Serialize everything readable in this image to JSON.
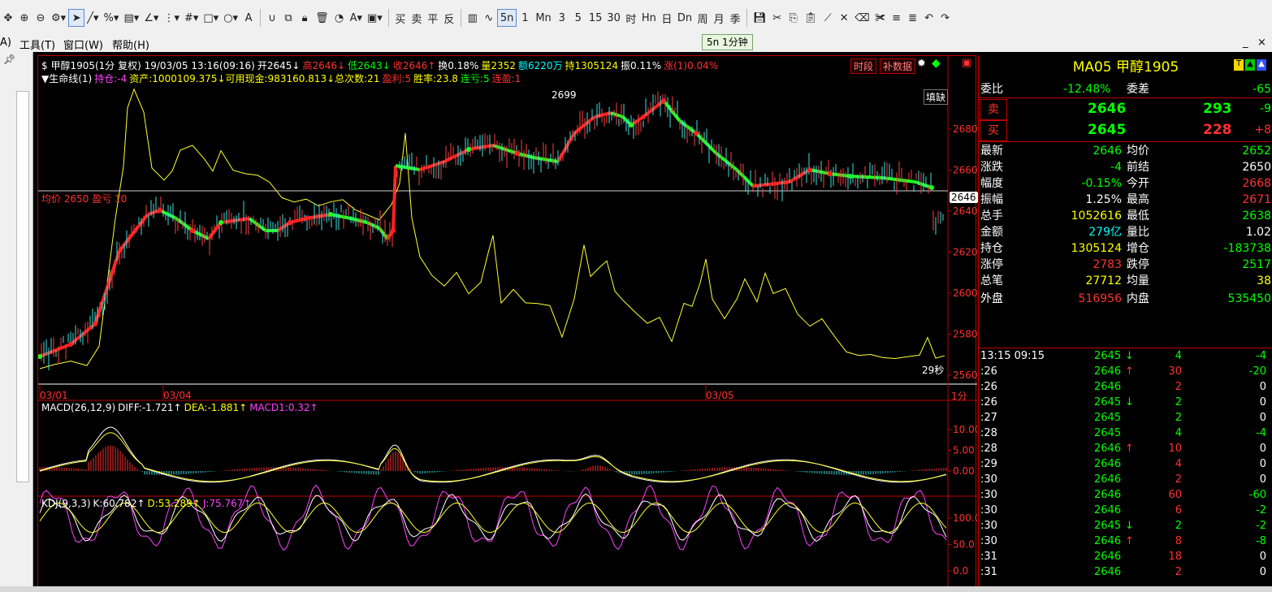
{
  "toolbar": {
    "sell_label": "买",
    "buy_label": "卖",
    "flat_label": "平",
    "reverse_label": "反",
    "periods": [
      "5n",
      "1",
      "Mn",
      "3",
      "5",
      "15",
      "30",
      "时",
      "Hn",
      "日",
      "Dn",
      "周",
      "月",
      "季"
    ]
  },
  "menu": {
    "items": [
      "A)",
      "工具(T)",
      "窗口(W)",
      "帮助(H)"
    ]
  },
  "tooltip": "5n 1分钟",
  "chart_header": {
    "line1": [
      {
        "text": "$ 甲醇1905(1分 复权) 19/03/05 13:16(09:16)",
        "color": "#ffffff"
      },
      {
        "text": "开2645↓",
        "color": "#ffffff"
      },
      {
        "text": "高2646↓",
        "color": "#ff3030"
      },
      {
        "text": "低2643↓",
        "color": "#00ff00"
      },
      {
        "text": "收2646↑",
        "color": "#ff3030"
      },
      {
        "text": "换0.18%",
        "color": "#ffffff"
      },
      {
        "text": "量2352",
        "color": "#ffff00"
      },
      {
        "text": "额6220万",
        "color": "#00ffff"
      },
      {
        "text": "持1305124",
        "color": "#ffff00"
      },
      {
        "text": "振0.11%",
        "color": "#ffffff"
      },
      {
        "text": "涨(1)0.04%",
        "color": "#ff3030"
      }
    ],
    "line2": [
      {
        "text": "▼生命线(1)",
        "color": "#ffffff"
      },
      {
        "text": "持仓:-4",
        "color": "#ff40ff"
      },
      {
        "text": "资产:1000109.375↓可用现金:983160.813↓总次数:21",
        "color": "#ffff00"
      },
      {
        "text": "盈利:5",
        "color": "#ff3030"
      },
      {
        "text": "胜率:23.8",
        "color": "#ffff00"
      },
      {
        "text": "连亏:5",
        "color": "#00ff00"
      },
      {
        "text": "连盈:1",
        "color": "#ff3030"
      }
    ],
    "buttons": [
      "时段",
      "补数据"
    ],
    "fill_gap_label": "填缺"
  },
  "avg_label": "均价 2650",
  "avg_label_suffix": "盈亏 10",
  "peak_label": "2699",
  "current_price_tag": "2646",
  "countdown": "29秒",
  "period_tag": "1分",
  "dates": [
    "03/01",
    "03/04",
    "03/05"
  ],
  "price_axis": [
    "2680",
    "2660",
    "2640",
    "2620",
    "2600",
    "2580",
    "2560"
  ],
  "macd": {
    "header": [
      {
        "text": "MACD(26,12,9)",
        "color": "#ffffff"
      },
      {
        "text": "DIFF:-1.721↑",
        "color": "#ffffff"
      },
      {
        "text": "DEA:-1.881↑",
        "color": "#ffff00"
      },
      {
        "text": "MACD1:0.32↑",
        "color": "#ff40ff"
      }
    ],
    "axis": [
      "10.00",
      "5.00",
      "0.00"
    ]
  },
  "kdj": {
    "header": [
      {
        "text": "KDJ(9,3,3)",
        "color": "#ffffff"
      },
      {
        "text": "K:60.782↑",
        "color": "#ffffff"
      },
      {
        "text": "D:53.289↑",
        "color": "#ffff00"
      },
      {
        "text": "J:75.767↑",
        "color": "#ff40ff"
      }
    ],
    "axis": [
      "100.0",
      "50.0",
      "0.0"
    ]
  },
  "quote": {
    "title": "MA05  甲醇1905",
    "weibi_label": "委比",
    "weibi": "-12.48%",
    "weicha_label": "委差",
    "weicha": "-65",
    "sell_label": "卖",
    "sell_price": "2646",
    "sell_vol": "293",
    "sell_chg": "-9",
    "buy_label": "买",
    "buy_price": "2645",
    "buy_vol": "228",
    "buy_chg": "+8",
    "stats": [
      {
        "l1": "最新",
        "v1": "2646",
        "c1": "#00ff00",
        "l2": "均价",
        "v2": "2652",
        "c2": "#00ff00"
      },
      {
        "l1": "涨跌",
        "v1": "-4",
        "c1": "#00ff00",
        "l2": "前结",
        "v2": "2650",
        "c2": "#ffffff"
      },
      {
        "l1": "幅度",
        "v1": "-0.15%",
        "c1": "#00ff00",
        "l2": "今开",
        "v2": "2668",
        "c2": "#ff3030"
      },
      {
        "l1": "振幅",
        "v1": "1.25%",
        "c1": "#ffffff",
        "l2": "最高",
        "v2": "2671",
        "c2": "#ff3030"
      },
      {
        "l1": "总手",
        "v1": "1052616",
        "c1": "#ffff00",
        "l2": "最低",
        "v2": "2638",
        "c2": "#00ff00"
      },
      {
        "l1": "金额",
        "v1": "279亿",
        "c1": "#00ffff",
        "l2": "量比",
        "v2": "1.02",
        "c2": "#ffffff"
      },
      {
        "l1": "持仓",
        "v1": "1305124",
        "c1": "#ffff00",
        "l2": "增仓",
        "v2": "-183738",
        "c2": "#00ff00"
      },
      {
        "l1": "涨停",
        "v1": "2783",
        "c1": "#ff3030",
        "l2": "跌停",
        "v2": "2517",
        "c2": "#00ff00"
      },
      {
        "l1": "总笔",
        "v1": "27712",
        "c1": "#ffff00",
        "l2": "均量",
        "v2": "38",
        "c2": "#ffff00"
      },
      {
        "l1": "外盘",
        "v1": "516956",
        "c1": "#ff3030",
        "l2": "内盘",
        "v2": "535450",
        "c2": "#00ff00"
      }
    ],
    "ticks": [
      {
        "t": "13:15 09:15",
        "p": "2645",
        "a": "↓",
        "ac": "#00ff00",
        "v": "4",
        "vc": "#00ff00",
        "d": "-4",
        "dc": "#00ff00"
      },
      {
        "t": ":26",
        "p": "2646",
        "a": "↑",
        "ac": "#ff3030",
        "v": "30",
        "vc": "#ff3030",
        "d": "-20",
        "dc": "#00ff00"
      },
      {
        "t": ":26",
        "p": "2646",
        "a": "",
        "ac": "#ffffff",
        "v": "2",
        "vc": "#ff3030",
        "d": "0",
        "dc": "#ffffff"
      },
      {
        "t": ":26",
        "p": "2645",
        "a": "↓",
        "ac": "#00ff00",
        "v": "2",
        "vc": "#00ff00",
        "d": "0",
        "dc": "#ffffff"
      },
      {
        "t": ":27",
        "p": "2645",
        "a": "",
        "ac": "#ffffff",
        "v": "2",
        "vc": "#00ff00",
        "d": "0",
        "dc": "#ffffff"
      },
      {
        "t": ":28",
        "p": "2645",
        "a": "",
        "ac": "#ffffff",
        "v": "4",
        "vc": "#00ff00",
        "d": "-4",
        "dc": "#00ff00"
      },
      {
        "t": ":28",
        "p": "2646",
        "a": "↑",
        "ac": "#ff3030",
        "v": "10",
        "vc": "#ff3030",
        "d": "0",
        "dc": "#ffffff"
      },
      {
        "t": ":29",
        "p": "2646",
        "a": "",
        "ac": "#ffffff",
        "v": "4",
        "vc": "#ff3030",
        "d": "0",
        "dc": "#ffffff"
      },
      {
        "t": ":30",
        "p": "2646",
        "a": "",
        "ac": "#ffffff",
        "v": "2",
        "vc": "#ff3030",
        "d": "0",
        "dc": "#ffffff"
      },
      {
        "t": ":30",
        "p": "2646",
        "a": "",
        "ac": "#ffffff",
        "v": "60",
        "vc": "#ff3030",
        "d": "-60",
        "dc": "#00ff00"
      },
      {
        "t": ":30",
        "p": "2646",
        "a": "",
        "ac": "#ffffff",
        "v": "6",
        "vc": "#ff3030",
        "d": "-2",
        "dc": "#00ff00"
      },
      {
        "t": ":30",
        "p": "2645",
        "a": "↓",
        "ac": "#00ff00",
        "v": "2",
        "vc": "#00ff00",
        "d": "-2",
        "dc": "#00ff00"
      },
      {
        "t": ":30",
        "p": "2646",
        "a": "↑",
        "ac": "#ff3030",
        "v": "8",
        "vc": "#ff3030",
        "d": "-8",
        "dc": "#00ff00"
      },
      {
        "t": ":31",
        "p": "2646",
        "a": "",
        "ac": "#ffffff",
        "v": "18",
        "vc": "#ff3030",
        "d": "0",
        "dc": "#ffffff"
      },
      {
        "t": ":31",
        "p": "2646",
        "a": "",
        "ac": "#ffffff",
        "v": "2",
        "vc": "#ff3030",
        "d": "0",
        "dc": "#ffffff"
      }
    ]
  }
}
